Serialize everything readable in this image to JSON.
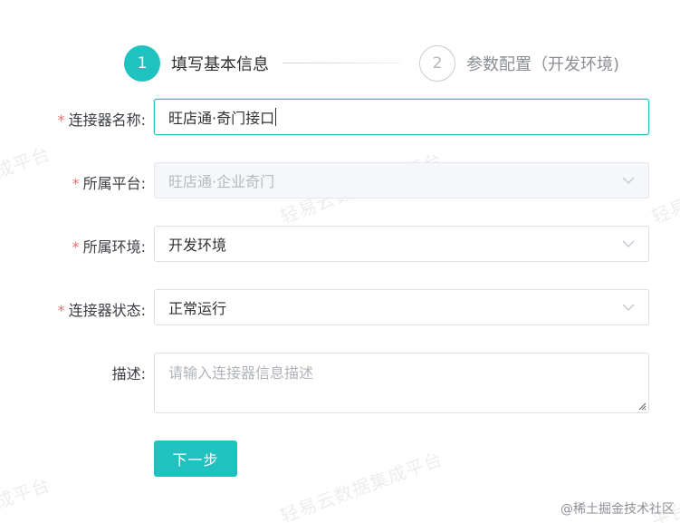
{
  "watermark": {
    "texts": [
      "成平台",
      "轻易云数据集成平台",
      "轻易",
      "成平台",
      "轻易云数据集成平台",
      "平台"
    ]
  },
  "steps": [
    {
      "number": "1",
      "title": "填写基本信息",
      "state": "active"
    },
    {
      "number": "2",
      "title": "参数配置（开发环境)",
      "state": "inactive"
    }
  ],
  "form": {
    "connector_name": {
      "label": "连接器名称:",
      "required": true,
      "value": "旺店通·奇门接口"
    },
    "platform": {
      "label": "所属平台:",
      "required": true,
      "value": "旺店通·企业奇门",
      "disabled": true
    },
    "environment": {
      "label": "所属环境:",
      "required": true,
      "value": "开发环境"
    },
    "status": {
      "label": "连接器状态:",
      "required": true,
      "value": "正常运行"
    },
    "description": {
      "label": "描述:",
      "required": false,
      "placeholder": "请输入连接器信息描述"
    }
  },
  "buttons": {
    "next_label": "下一步"
  },
  "footer": {
    "credit": "@稀土掘金技术社区"
  },
  "colors": {
    "accent": "#1fc2bf",
    "required": "#f56c6c",
    "border": "#dcdfe6"
  }
}
